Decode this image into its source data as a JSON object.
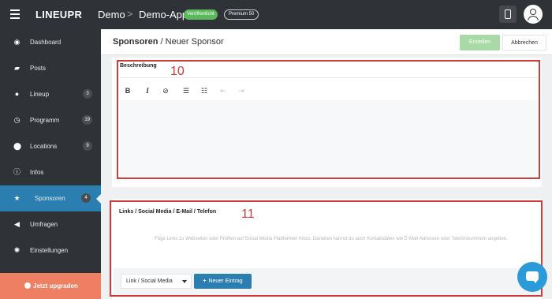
{
  "topbar": {
    "logo": "LINEUPR",
    "org": "Demo",
    "separator": ">",
    "app": "Demo-App",
    "status_badge": "Veröffentlicht",
    "plan_badge": "Premium 50"
  },
  "sidebar": {
    "items": [
      {
        "label": "Dashboard",
        "icon": "dashboard-icon",
        "count": null
      },
      {
        "label": "Posts",
        "icon": "comment-icon",
        "count": null
      },
      {
        "label": "Lineup",
        "icon": "user-icon",
        "count": "3"
      },
      {
        "label": "Programm",
        "icon": "clock-icon",
        "count": "19"
      },
      {
        "label": "Locations",
        "icon": "map-pin-icon",
        "count": "9"
      },
      {
        "label": "Infos",
        "icon": "info-icon",
        "count": null
      },
      {
        "label": "Sponsoren",
        "icon": "star-icon",
        "count": "4"
      },
      {
        "label": "Umfragen",
        "icon": "megaphone-icon",
        "count": null
      },
      {
        "label": "Einstellungen",
        "icon": "gear-icon",
        "count": null
      }
    ],
    "active": "Sponsoren",
    "upgrade_label": "Jetzt upgraden"
  },
  "header": {
    "title_strong": "Sponsoren",
    "title_rest": " / Neuer Sponsor",
    "create_label": "Erstellen",
    "cancel_label": "Abbrechen"
  },
  "description": {
    "label": "Beschreibung",
    "annotation": "10",
    "toolbar": [
      "bold-icon",
      "italic-icon",
      "link-icon",
      "bullet-list-icon",
      "numbered-list-icon",
      "outdent-icon",
      "indent-icon"
    ]
  },
  "links": {
    "label": "Links / Social Media / E-Mail / Telefon",
    "annotation": "11",
    "help_text": "Füge Links zu Webseiten oder Profilen auf Social Media Plattformen hinzu. Daneben kannst du auch Kontaktdaten wie E-Mail-Adressen oder Telefonnummern angeben.",
    "type_select": "Link / Social Media",
    "new_entry_label": "Neuer Eintrag"
  },
  "colors": {
    "sidebar": "#2f3236",
    "accent": "#2a7fb0",
    "success": "#5cb85c",
    "upgrade": "#ef7f62",
    "annotation": "#d23b3b"
  }
}
